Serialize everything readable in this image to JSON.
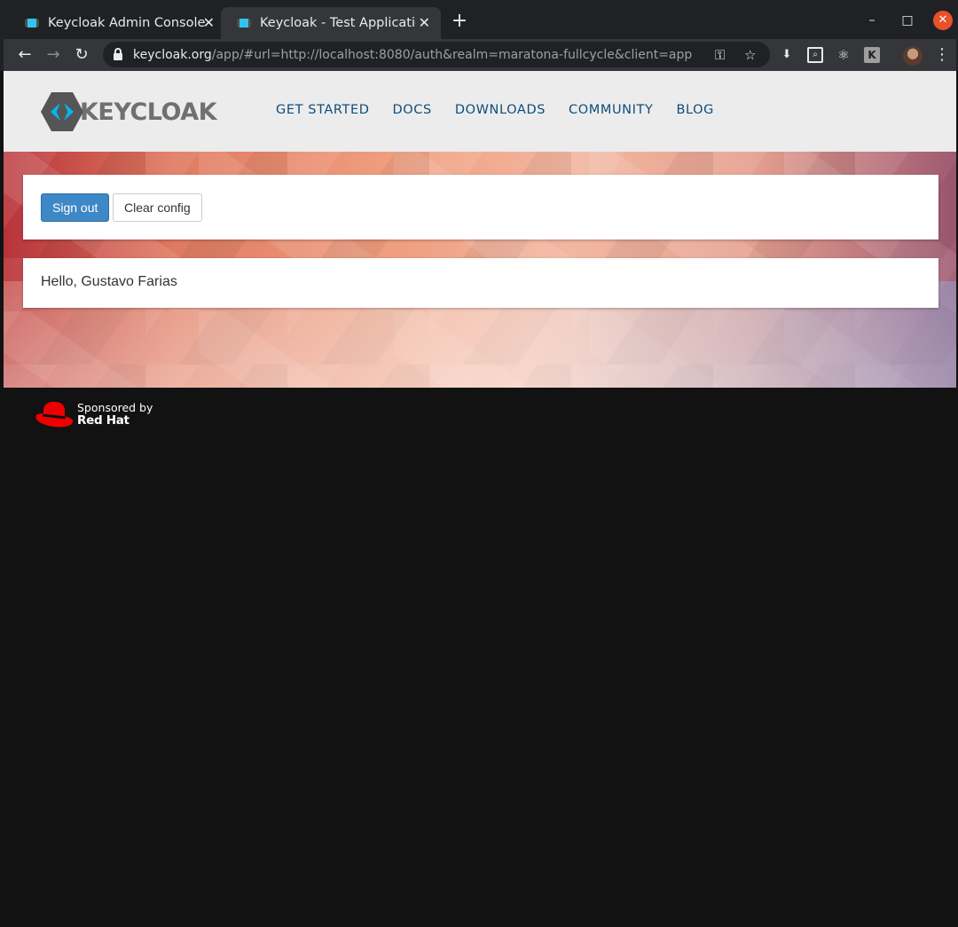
{
  "browser": {
    "tabs": [
      {
        "title": "Keycloak Admin Console",
        "active": false
      },
      {
        "title": "Keycloak - Test Applicatio",
        "active": true
      }
    ],
    "new_tab_icon": "+",
    "window_controls": {
      "minimize": "–",
      "maximize": "□",
      "close": "✕"
    },
    "url": {
      "host": "keycloak.org",
      "rest": "/app/#url=http://localhost:8080/auth&realm=maratona-fullcycle&client=app"
    },
    "extensions": [
      "download-icon",
      "zoom-inspect-icon",
      "react-icon",
      "K"
    ],
    "ext_k_label": "K"
  },
  "site": {
    "logo_text": "KEYCLOAK",
    "nav": [
      "GET STARTED",
      "DOCS",
      "DOWNLOADS",
      "COMMUNITY",
      "BLOG"
    ]
  },
  "app": {
    "sign_out_label": "Sign out",
    "clear_config_label": "Clear config",
    "greeting": "Hello, Gustavo Farias"
  },
  "footer": {
    "sponsored_by": "Sponsored by",
    "sponsor_name": "Red Hat",
    "brand_color": "#ee0000"
  },
  "colors": {
    "primary_button": "#3f88c7",
    "nav_link": "#0f4d7a",
    "page_background": "#121212"
  }
}
